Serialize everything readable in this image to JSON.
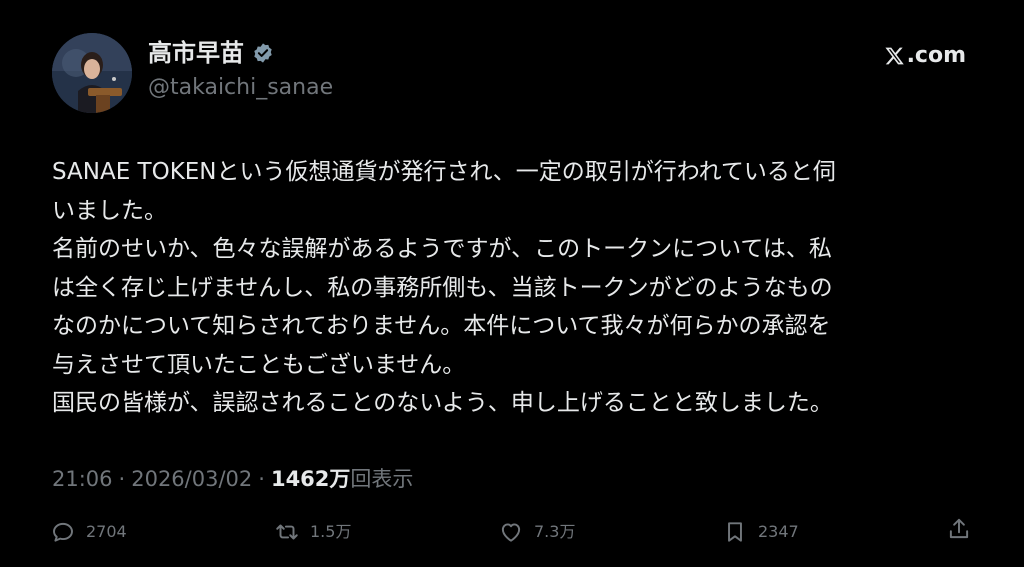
{
  "author": {
    "display_name": "高市早苗",
    "handle": "@takaichi_sanae",
    "verified": true,
    "avatar": "profile-photo"
  },
  "site": {
    "logo": "x-logo-icon",
    "label": ".com"
  },
  "tweet": {
    "lines": [
      "SANAE TOKENという仮想通貨が発行され、一定の取引が行われていると伺",
      "いました。",
      "名前のせいか、色々な誤解があるようですが、このトークンについては、私",
      "は全く存じ上げませんし、私の事務所側も、当該トークンがどのようなもの",
      "なのかについて知らされておりません。本件について我々が何らかの承認を",
      "与えさせて頂いたこともございません。",
      "国民の皆様が、誤認されることのないよう、申し上げることと致しました。"
    ]
  },
  "meta": {
    "time": "21:06",
    "separator": "·",
    "date": "2026/03/02",
    "views_count": "1462万",
    "views_label": "回表示"
  },
  "actions": {
    "reply": {
      "icon": "reply-icon",
      "count": "2704"
    },
    "repost": {
      "icon": "repost-icon",
      "count": "1.5万"
    },
    "like": {
      "icon": "heart-icon",
      "count": "7.3万"
    },
    "bookmark": {
      "icon": "bookmark-icon",
      "count": "2347"
    },
    "share": {
      "icon": "share-icon"
    }
  },
  "colors": {
    "background": "#000000",
    "text_primary": "#e7e9ea",
    "text_secondary": "#71767b",
    "verified_badge": "#829aab"
  }
}
